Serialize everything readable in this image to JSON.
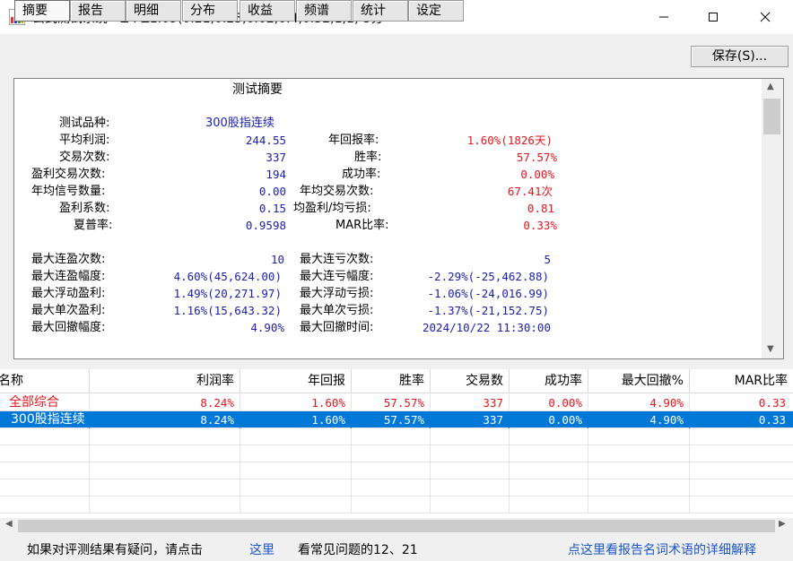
{
  "window": {
    "title": "公式测试系统 - Z : Z1.09(0.21,0.25,0.02,0.4,0.32,1,1) 5分"
  },
  "tabs": [
    "摘要",
    "报告",
    "明细",
    "分布",
    "收益",
    "频谱",
    "统计",
    "设定"
  ],
  "active_tab": "摘要",
  "save_button": "保存(S)...",
  "summary": {
    "heading": "测试摘要",
    "label_instrument": "测试品种:",
    "value_instrument": "300股指连续",
    "label_avg_profit": "平均利润:",
    "value_avg_profit": "244.55",
    "label_annual_return": "年回报率:",
    "value_annual_return": "1.60%(1826天)",
    "label_trades": "交易次数:",
    "value_trades": "337",
    "label_win_rate": "胜率:",
    "value_win_rate": "57.57%",
    "label_winning_trades": "盈利交易次数:",
    "value_winning_trades": "194",
    "label_success_rate": "成功率:",
    "value_success_rate": "0.00%",
    "label_annual_signals": "年均信号数量:",
    "value_annual_signals": "0.00",
    "label_annual_trades": "年均交易次数:",
    "value_annual_trades": "67.41次",
    "label_profit_factor": "盈利系数:",
    "value_profit_factor": "0.15",
    "label_avg_win_loss": "均盈利/均亏损:",
    "value_avg_win_loss": "0.81",
    "label_sharpe": "夏普率:",
    "value_sharpe": "0.9598",
    "label_mar": "MAR比率:",
    "value_mar": "0.33%",
    "label_max_consec_wins": "最大连盈次数:",
    "value_max_consec_wins": "10",
    "label_max_consec_losses": "最大连亏次数:",
    "value_max_consec_losses": "5",
    "label_max_consec_win_amt": "最大连盈幅度:",
    "value_max_consec_win_amt": "4.60%(45,624.00)",
    "label_max_consec_loss_amt": "最大连亏幅度:",
    "value_max_consec_loss_amt": "-2.29%(-25,462.88)",
    "label_max_float_profit": "最大浮动盈利:",
    "value_max_float_profit": "1.49%(20,271.97)",
    "label_max_float_loss": "最大浮动亏损:",
    "value_max_float_loss": "-1.06%(-24,016.99)",
    "label_max_single_profit": "最大单次盈利:",
    "value_max_single_profit": "1.16%(15,643.32)",
    "label_max_single_loss": "最大单次亏损:",
    "value_max_single_loss": "-1.37%(-21,152.75)",
    "label_max_drawdown": "最大回撤幅度:",
    "value_max_drawdown": "4.90%",
    "label_max_drawdown_time": "最大回撤时间:",
    "value_max_drawdown_time": "2024/10/22 11:30:00"
  },
  "table": {
    "columns": [
      "名称",
      "利润率",
      "年回报",
      "胜率",
      "交易数",
      "成功率",
      "最大回撤%",
      "MAR比率"
    ],
    "rows": [
      [
        "全部综合",
        "8.24%",
        "1.60%",
        "57.57%",
        "337",
        "0.00%",
        "4.90%",
        "0.33"
      ],
      [
        "300股指连续",
        "8.24%",
        "1.60%",
        "57.57%",
        "337",
        "0.00%",
        "4.90%",
        "0.33"
      ]
    ]
  },
  "footer": {
    "question_text": "如果对评测结果有疑问，请点击",
    "here_link": "这里",
    "faq_text": "看常见问题的12、21",
    "glossary_link": "点这里看报告名词术语的详细解释"
  },
  "colors": {
    "label": "#000000",
    "value_blue": "#1d20a8",
    "value_red": "#e2151d",
    "selection": "#0078d7",
    "link": "#1b55c8"
  }
}
